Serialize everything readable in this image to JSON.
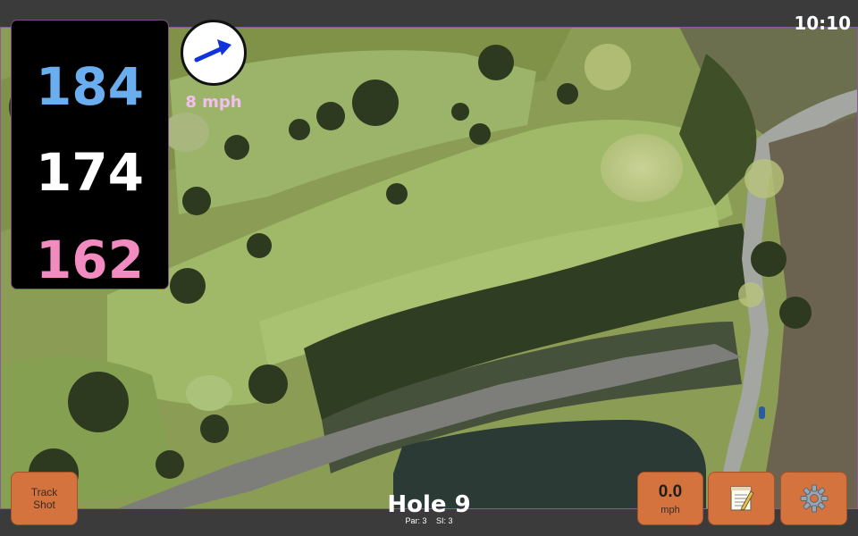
{
  "status": {
    "time": "10:10"
  },
  "distances": {
    "back": "184",
    "middle": "174",
    "front": "162"
  },
  "wind": {
    "speed": "8 mph",
    "icon": "wind-arrow-icon"
  },
  "hole": {
    "title": "Hole 9",
    "par": "Par: 3",
    "si": "SI: 3"
  },
  "controls": {
    "track_shot": "Track\nShot",
    "speed_value": "0.0",
    "speed_unit": "mph",
    "notes_icon": "notepad-icon",
    "settings_icon": "gear-icon"
  },
  "colors": {
    "back": "#6aaef0",
    "middle": "#ffffff",
    "front": "#f28bbf",
    "button": "#d4733d",
    "wind_text": "#f4bff0"
  }
}
